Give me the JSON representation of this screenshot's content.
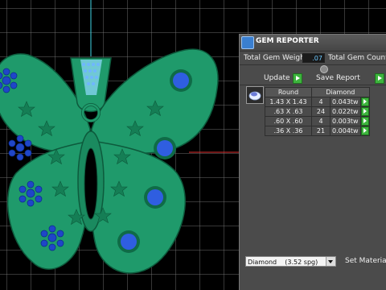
{
  "viewport": {
    "colors": {
      "background": "#000000",
      "grid": "#6e6e6e",
      "body": "#1f9a6b",
      "outline": "#0d5a3c",
      "gem": "#1f46c8"
    }
  },
  "panel": {
    "title": "GEM REPORTER",
    "total_weight_label": "Total Gem Weight",
    "total_weight_value": ".07",
    "total_count_label": "Total Gem Count",
    "update_label": "Update",
    "save_report_label": "Save Report",
    "table": {
      "headers": [
        "Round",
        "Diamond"
      ],
      "rows": [
        {
          "size": "1.43 X 1.43",
          "count": "4",
          "weight": "0.043tw"
        },
        {
          "size": ".63 X .63",
          "count": "24",
          "weight": "0.022tw"
        },
        {
          "size": ".60 X .60",
          "count": "4",
          "weight": "0.003tw"
        },
        {
          "size": ".36 X .36",
          "count": "21",
          "weight": "0.004tw"
        }
      ]
    },
    "material_select_value": "Diamond    (3.52 spg)",
    "set_material_label": "Set Material"
  }
}
